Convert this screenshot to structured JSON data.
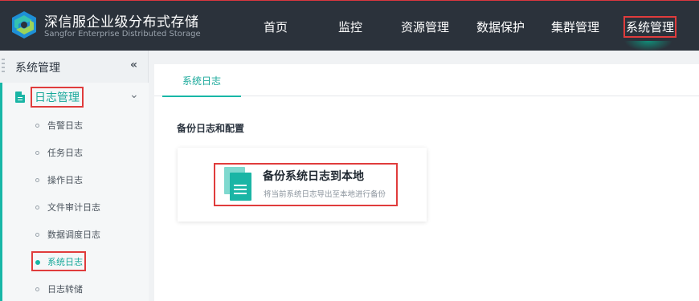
{
  "brand": {
    "name_cn": "深信服企业级分布式存储",
    "name_en": "Sangfor Enterprise Distributed Storage",
    "accent": "#18b7a7"
  },
  "topnav": {
    "items": [
      {
        "label": "首页"
      },
      {
        "label": "监控"
      },
      {
        "label": "资源管理"
      },
      {
        "label": "数据保护"
      },
      {
        "label": "集群管理"
      },
      {
        "label": "系统管理",
        "active": true
      }
    ]
  },
  "sidebar": {
    "title": "系统管理",
    "collapse_icon": "double-chevron-left-icon",
    "group": {
      "label": "日志管理",
      "icon": "document-icon",
      "items": [
        {
          "label": "告警日志"
        },
        {
          "label": "任务日志"
        },
        {
          "label": "操作日志"
        },
        {
          "label": "文件审计日志"
        },
        {
          "label": "数据调度日志"
        },
        {
          "label": "系统日志",
          "active": true
        },
        {
          "label": "日志转储"
        }
      ]
    }
  },
  "main": {
    "tab": "系统日志",
    "section_title": "备份日志和配置",
    "card": {
      "title": "备份系统日志到本地",
      "description": "将当前系统日志导出至本地进行备份",
      "icon": "documents-stack-icon"
    }
  }
}
